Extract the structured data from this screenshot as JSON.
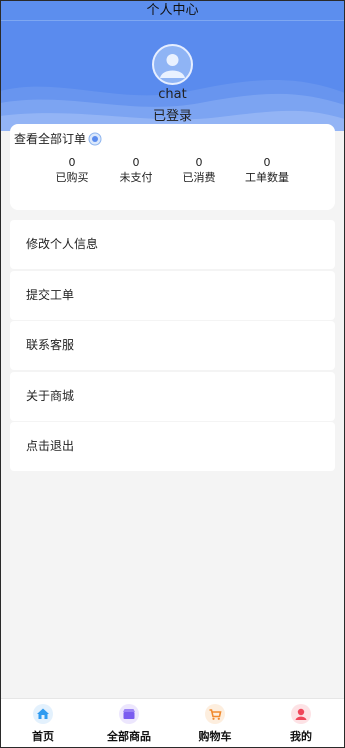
{
  "header": {
    "title": "个人中心"
  },
  "profile": {
    "username": "chat",
    "status": "已登录"
  },
  "orders": {
    "title": "查看全部订单",
    "stats": [
      {
        "value": "0",
        "label": "已购买"
      },
      {
        "value": "0",
        "label": "未支付"
      },
      {
        "value": "0",
        "label": "已消费"
      },
      {
        "value": "0",
        "label": "工单数量"
      }
    ]
  },
  "menu": [
    {
      "label": "修改个人信息"
    },
    {
      "label": "提交工单"
    },
    {
      "label": "联系客服"
    },
    {
      "label": "关于商城"
    },
    {
      "label": "点击退出"
    }
  ],
  "tabbar": [
    {
      "label": "首页",
      "icon": "home-icon",
      "color": "#2f9bf0"
    },
    {
      "label": "全部商品",
      "icon": "shop-icon",
      "color": "#7a5cf0"
    },
    {
      "label": "购物车",
      "icon": "cart-icon",
      "color": "#f08a2f"
    },
    {
      "label": "我的",
      "icon": "user-icon",
      "color": "#f0465a"
    }
  ],
  "colors": {
    "brand": "#5a8bee",
    "background": "#f4f4f4"
  }
}
